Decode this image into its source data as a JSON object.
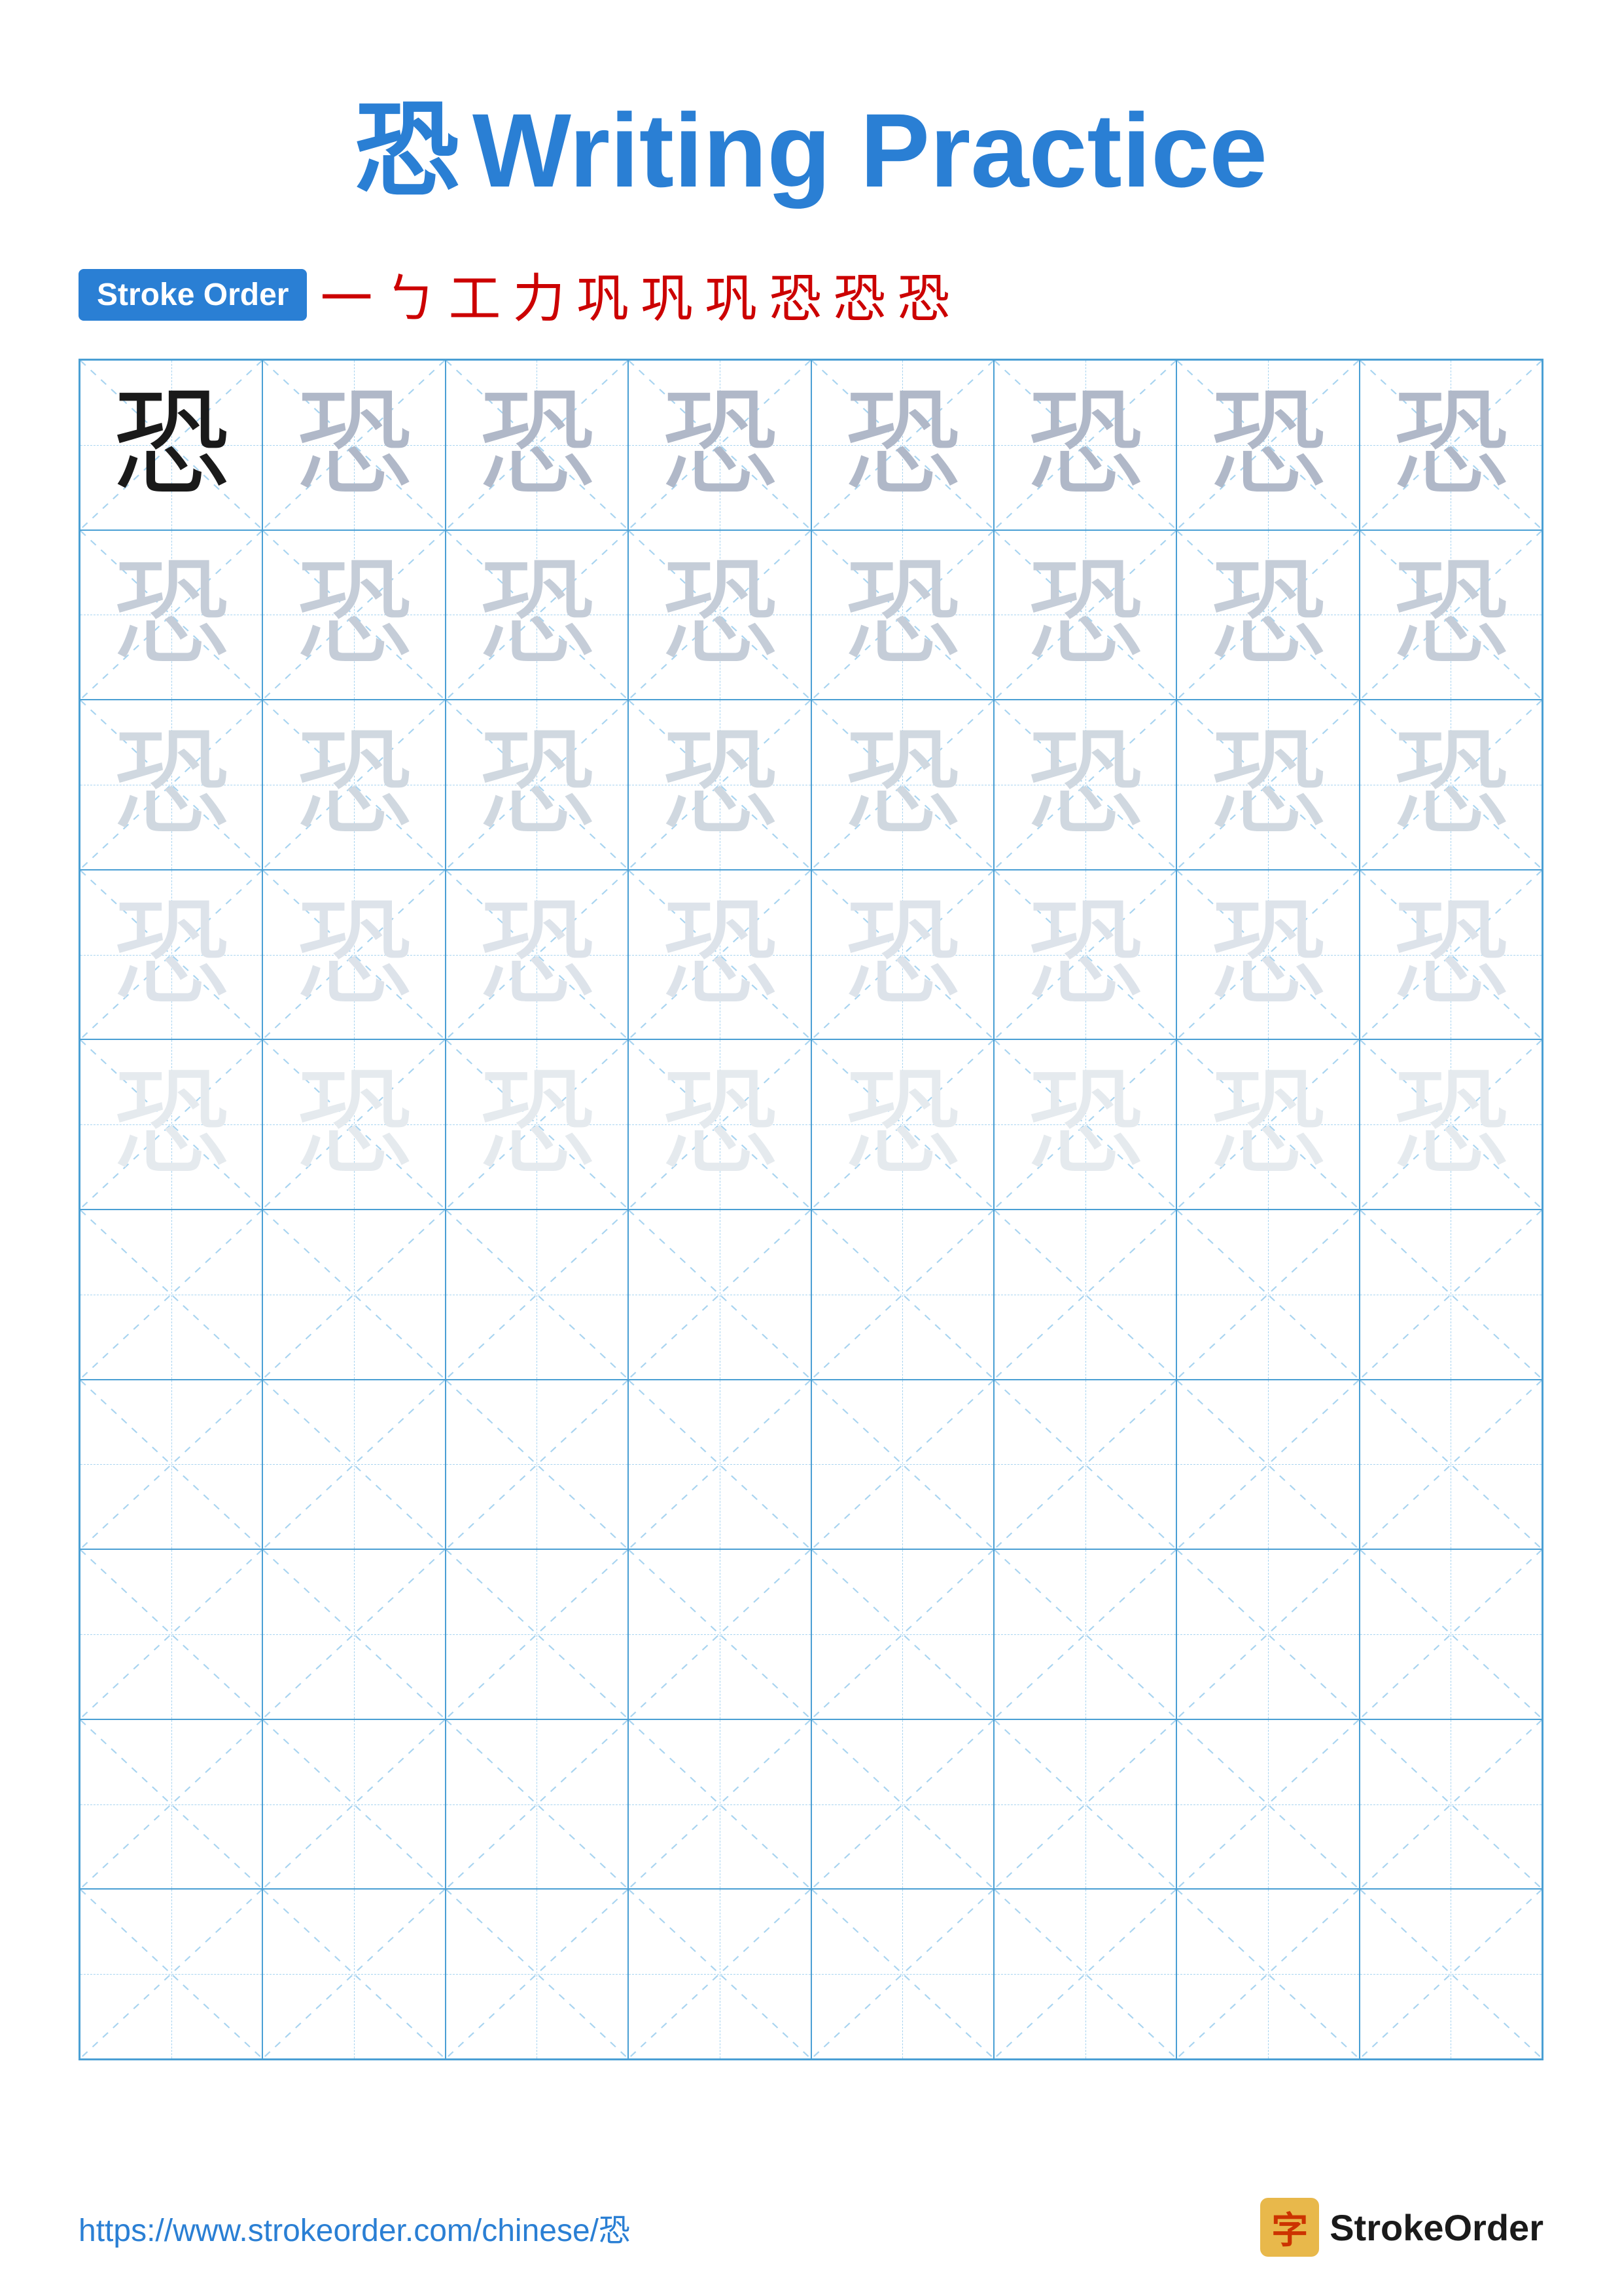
{
  "title": {
    "char": "恐",
    "text": "Writing Practice"
  },
  "stroke_order": {
    "badge_label": "Stroke Order",
    "sequence": [
      "一",
      "ㄅ",
      "工",
      "力",
      "巩",
      "巩",
      "巩",
      "恐",
      "恐",
      "恐"
    ]
  },
  "grid": {
    "rows": 10,
    "cols": 8,
    "character": "恐",
    "practice_rows": 5
  },
  "footer": {
    "url": "https://www.strokeorder.com/chinese/恐",
    "logo_char": "字",
    "logo_text": "StrokeOrder"
  }
}
